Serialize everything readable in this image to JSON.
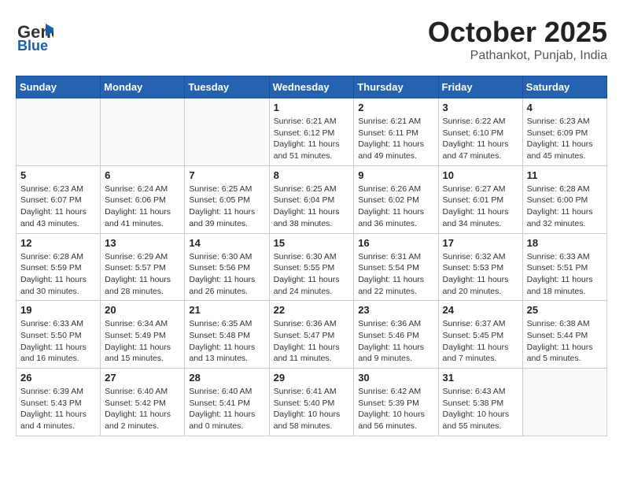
{
  "header": {
    "logo_general": "General",
    "logo_blue": "Blue",
    "month": "October 2025",
    "location": "Pathankot, Punjab, India"
  },
  "days_of_week": [
    "Sunday",
    "Monday",
    "Tuesday",
    "Wednesday",
    "Thursday",
    "Friday",
    "Saturday"
  ],
  "weeks": [
    [
      {
        "day": "",
        "info": ""
      },
      {
        "day": "",
        "info": ""
      },
      {
        "day": "",
        "info": ""
      },
      {
        "day": "1",
        "info": "Sunrise: 6:21 AM\nSunset: 6:12 PM\nDaylight: 11 hours\nand 51 minutes."
      },
      {
        "day": "2",
        "info": "Sunrise: 6:21 AM\nSunset: 6:11 PM\nDaylight: 11 hours\nand 49 minutes."
      },
      {
        "day": "3",
        "info": "Sunrise: 6:22 AM\nSunset: 6:10 PM\nDaylight: 11 hours\nand 47 minutes."
      },
      {
        "day": "4",
        "info": "Sunrise: 6:23 AM\nSunset: 6:09 PM\nDaylight: 11 hours\nand 45 minutes."
      }
    ],
    [
      {
        "day": "5",
        "info": "Sunrise: 6:23 AM\nSunset: 6:07 PM\nDaylight: 11 hours\nand 43 minutes."
      },
      {
        "day": "6",
        "info": "Sunrise: 6:24 AM\nSunset: 6:06 PM\nDaylight: 11 hours\nand 41 minutes."
      },
      {
        "day": "7",
        "info": "Sunrise: 6:25 AM\nSunset: 6:05 PM\nDaylight: 11 hours\nand 39 minutes."
      },
      {
        "day": "8",
        "info": "Sunrise: 6:25 AM\nSunset: 6:04 PM\nDaylight: 11 hours\nand 38 minutes."
      },
      {
        "day": "9",
        "info": "Sunrise: 6:26 AM\nSunset: 6:02 PM\nDaylight: 11 hours\nand 36 minutes."
      },
      {
        "day": "10",
        "info": "Sunrise: 6:27 AM\nSunset: 6:01 PM\nDaylight: 11 hours\nand 34 minutes."
      },
      {
        "day": "11",
        "info": "Sunrise: 6:28 AM\nSunset: 6:00 PM\nDaylight: 11 hours\nand 32 minutes."
      }
    ],
    [
      {
        "day": "12",
        "info": "Sunrise: 6:28 AM\nSunset: 5:59 PM\nDaylight: 11 hours\nand 30 minutes."
      },
      {
        "day": "13",
        "info": "Sunrise: 6:29 AM\nSunset: 5:57 PM\nDaylight: 11 hours\nand 28 minutes."
      },
      {
        "day": "14",
        "info": "Sunrise: 6:30 AM\nSunset: 5:56 PM\nDaylight: 11 hours\nand 26 minutes."
      },
      {
        "day": "15",
        "info": "Sunrise: 6:30 AM\nSunset: 5:55 PM\nDaylight: 11 hours\nand 24 minutes."
      },
      {
        "day": "16",
        "info": "Sunrise: 6:31 AM\nSunset: 5:54 PM\nDaylight: 11 hours\nand 22 minutes."
      },
      {
        "day": "17",
        "info": "Sunrise: 6:32 AM\nSunset: 5:53 PM\nDaylight: 11 hours\nand 20 minutes."
      },
      {
        "day": "18",
        "info": "Sunrise: 6:33 AM\nSunset: 5:51 PM\nDaylight: 11 hours\nand 18 minutes."
      }
    ],
    [
      {
        "day": "19",
        "info": "Sunrise: 6:33 AM\nSunset: 5:50 PM\nDaylight: 11 hours\nand 16 minutes."
      },
      {
        "day": "20",
        "info": "Sunrise: 6:34 AM\nSunset: 5:49 PM\nDaylight: 11 hours\nand 15 minutes."
      },
      {
        "day": "21",
        "info": "Sunrise: 6:35 AM\nSunset: 5:48 PM\nDaylight: 11 hours\nand 13 minutes."
      },
      {
        "day": "22",
        "info": "Sunrise: 6:36 AM\nSunset: 5:47 PM\nDaylight: 11 hours\nand 11 minutes."
      },
      {
        "day": "23",
        "info": "Sunrise: 6:36 AM\nSunset: 5:46 PM\nDaylight: 11 hours\nand 9 minutes."
      },
      {
        "day": "24",
        "info": "Sunrise: 6:37 AM\nSunset: 5:45 PM\nDaylight: 11 hours\nand 7 minutes."
      },
      {
        "day": "25",
        "info": "Sunrise: 6:38 AM\nSunset: 5:44 PM\nDaylight: 11 hours\nand 5 minutes."
      }
    ],
    [
      {
        "day": "26",
        "info": "Sunrise: 6:39 AM\nSunset: 5:43 PM\nDaylight: 11 hours\nand 4 minutes."
      },
      {
        "day": "27",
        "info": "Sunrise: 6:40 AM\nSunset: 5:42 PM\nDaylight: 11 hours\nand 2 minutes."
      },
      {
        "day": "28",
        "info": "Sunrise: 6:40 AM\nSunset: 5:41 PM\nDaylight: 11 hours\nand 0 minutes."
      },
      {
        "day": "29",
        "info": "Sunrise: 6:41 AM\nSunset: 5:40 PM\nDaylight: 10 hours\nand 58 minutes."
      },
      {
        "day": "30",
        "info": "Sunrise: 6:42 AM\nSunset: 5:39 PM\nDaylight: 10 hours\nand 56 minutes."
      },
      {
        "day": "31",
        "info": "Sunrise: 6:43 AM\nSunset: 5:38 PM\nDaylight: 10 hours\nand 55 minutes."
      },
      {
        "day": "",
        "info": ""
      }
    ]
  ]
}
